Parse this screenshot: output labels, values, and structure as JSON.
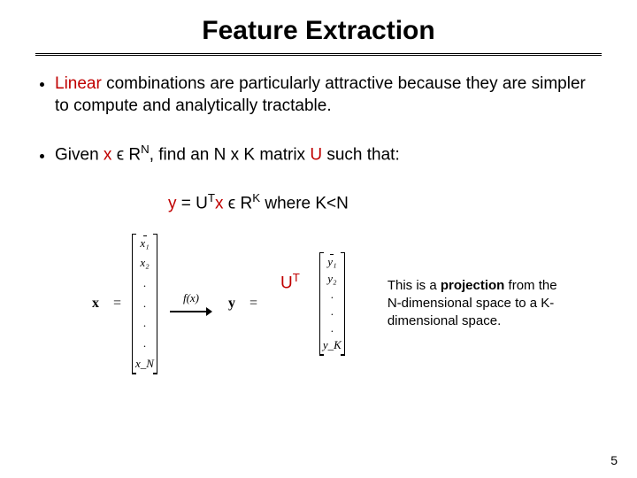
{
  "title": "Feature Extraction",
  "bullets": {
    "b1_pre": "",
    "b1_linear": "Linear",
    "b1_rest": "  combinations are particularly attractive because they are simpler to compute and analytically tractable.",
    "b2_pre": "Given ",
    "b2_x": "x",
    "b2_mid1": " ϵ R",
    "b2_supN": "N",
    "b2_mid2": ", find an N x K matrix ",
    "b2_U": "U",
    "b2_end": " such that:"
  },
  "equation": {
    "y": "y",
    "eq": " = U",
    "supT": "T",
    "x": "x",
    "sp": "  ϵ R",
    "supK": "K",
    "where": " where K<N"
  },
  "figure": {
    "x_label": "x",
    "eqsign": "=",
    "x_entries": [
      "x₁",
      "x₂",
      ".",
      ".",
      ".",
      ".",
      "x_N"
    ],
    "fx": "f(x)",
    "ut": "U",
    "ut_sup": "T",
    "y_label": "y",
    "y_entries": [
      "y₁",
      "y₂",
      ".",
      ".",
      ".",
      "y_K"
    ]
  },
  "caption": {
    "pre": "This is a ",
    "proj": "projection",
    "rest": " from the N-dimensional space to a K-dimensional space."
  },
  "page": "5"
}
